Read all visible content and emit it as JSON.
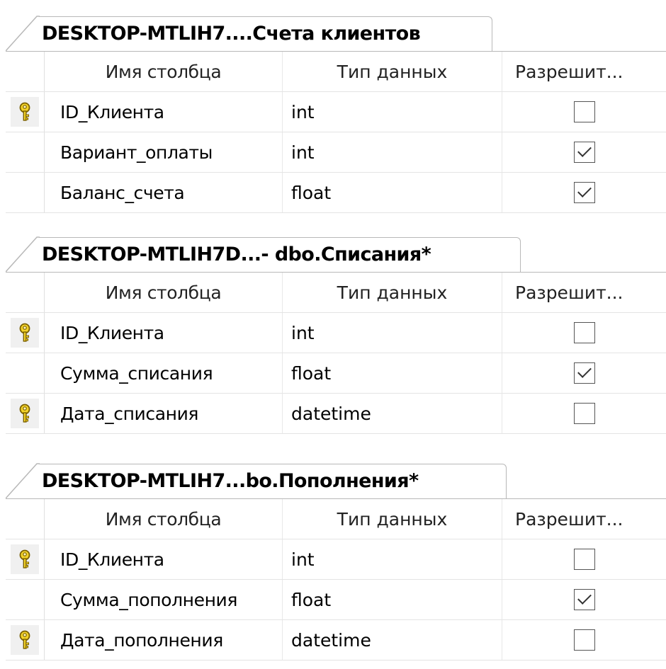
{
  "columns": {
    "name": "Имя столбца",
    "type": "Тип данных",
    "nullable": "Разрешит..."
  },
  "tables": [
    {
      "tab_title": "DESKTOP-MTLIH7....Счета клиентов",
      "rows": [
        {
          "name": "ID_Клиента",
          "type": "int",
          "key": true,
          "allow_nulls": false
        },
        {
          "name": "Вариант_оплаты",
          "type": "int",
          "key": false,
          "allow_nulls": true
        },
        {
          "name": "Баланс_счета",
          "type": "float",
          "key": false,
          "allow_nulls": true
        }
      ]
    },
    {
      "tab_title": "DESKTOP-MTLIH7D...- dbo.Списания*",
      "rows": [
        {
          "name": "ID_Клиента",
          "type": "int",
          "key": true,
          "allow_nulls": false
        },
        {
          "name": "Сумма_списания",
          "type": "float",
          "key": false,
          "allow_nulls": true
        },
        {
          "name": "Дата_списания",
          "type": "datetime",
          "key": true,
          "allow_nulls": false
        }
      ]
    },
    {
      "tab_title": "DESKTOP-MTLIH7...bo.Пополнения*",
      "rows": [
        {
          "name": "ID_Клиента",
          "type": "int",
          "key": true,
          "allow_nulls": false
        },
        {
          "name": "Сумма_пополнения",
          "type": "float",
          "key": false,
          "allow_nulls": true
        },
        {
          "name": "Дата_пополнения",
          "type": "datetime",
          "key": true,
          "allow_nulls": false
        }
      ]
    }
  ],
  "icons": {
    "primary_key": "key-icon",
    "checkbox": "checkbox-icon"
  }
}
